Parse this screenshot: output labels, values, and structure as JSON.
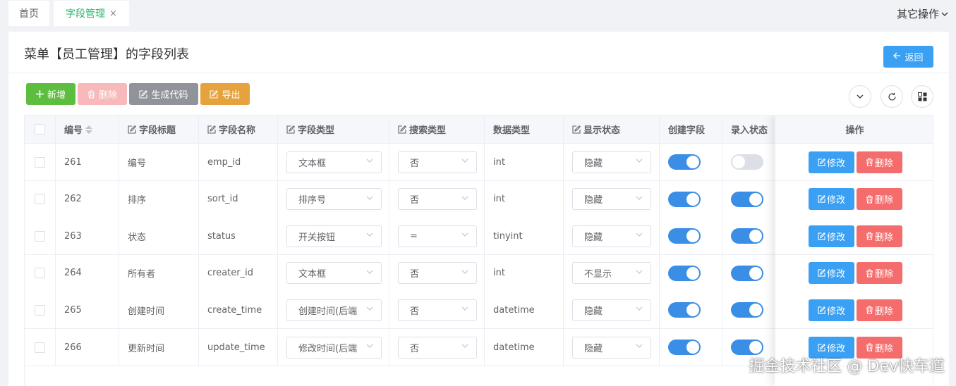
{
  "tabs": [
    {
      "label": "首页"
    },
    {
      "label": "字段管理",
      "close": "×"
    }
  ],
  "other_ops": "其它操作",
  "page_title": "菜单【员工管理】的字段列表",
  "back_label": "返回",
  "toolbar": {
    "add_label": "新增",
    "delete_label": "删除",
    "gen_label": "生成代码",
    "export_label": "导出"
  },
  "columns": [
    "编号",
    "字段标题",
    "字段名称",
    "字段类型",
    "搜索类型",
    "数据类型",
    "显示状态",
    "创建字段",
    "录入状态",
    "操作"
  ],
  "actions": {
    "edit": "修改",
    "delete": "删除"
  },
  "rows": [
    {
      "id": "261",
      "title": "编号",
      "name": "emp_id",
      "ftype": "文本框",
      "stype": "否",
      "dtype": "int",
      "display": "隐藏",
      "create": true,
      "entry": false
    },
    {
      "id": "262",
      "title": "排序",
      "name": "sort_id",
      "ftype": "排序号",
      "stype": "否",
      "dtype": "int",
      "display": "隐藏",
      "create": true,
      "entry": true
    },
    {
      "id": "263",
      "title": "状态",
      "name": "status",
      "ftype": "开关按钮",
      "stype": "=",
      "dtype": "tinyint",
      "display": "隐藏",
      "create": true,
      "entry": true
    },
    {
      "id": "264",
      "title": "所有者",
      "name": "creater_id",
      "ftype": "文本框",
      "stype": "否",
      "dtype": "int",
      "display": "不显示",
      "create": true,
      "entry": true
    },
    {
      "id": "265",
      "title": "创建时间",
      "name": "create_time",
      "ftype": "创建时间(后端",
      "stype": "否",
      "dtype": "datetime",
      "display": "隐藏",
      "create": true,
      "entry": true
    },
    {
      "id": "266",
      "title": "更新时间",
      "name": "update_time",
      "ftype": "修改时间(后端",
      "stype": "否",
      "dtype": "datetime",
      "display": "隐藏",
      "create": true,
      "entry": true
    }
  ],
  "watermark": "掘金技术社区 @ Dev快车道",
  "colors": {
    "primary": "#3aa0f3",
    "success": "#5dbd3f",
    "danger": "#f56c6c",
    "warning": "#e6a23c",
    "info": "#909399",
    "tab_active": "#26b56a"
  }
}
